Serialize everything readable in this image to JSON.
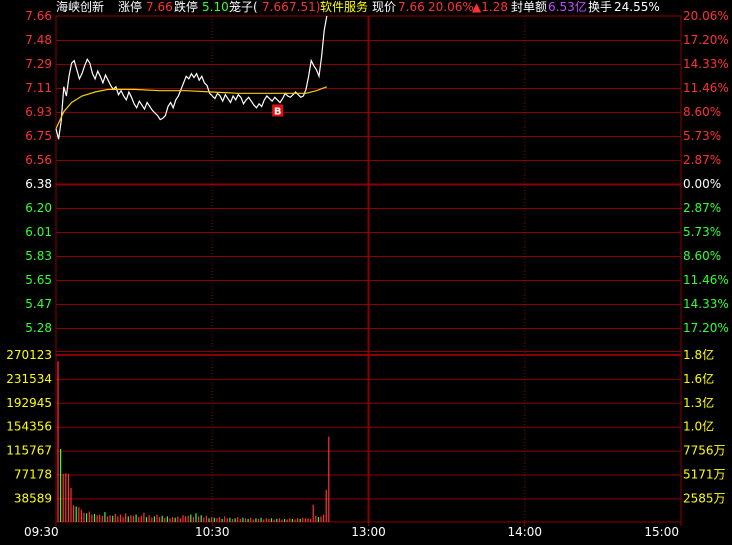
{
  "header": {
    "name": "海峡创新",
    "limit_up_label": "涨停",
    "limit_up": "7.66",
    "limit_down_label": "跌停",
    "limit_down": "5.10",
    "cage_label": "笼子(",
    "cage_value_1": "7.66",
    "cage_value_2": "7.51)",
    "sector": "软件服务",
    "price_label": "现价",
    "price": "7.66",
    "pct": "20.06%",
    "change": "▲1.28",
    "seal_label": "封单额",
    "seal_value": "6.53亿",
    "turnover_label": "换手",
    "turnover": "24.55%"
  },
  "colors": {
    "grid": "#8a0000",
    "up": "#ff3232",
    "down": "#33ff33",
    "neutral": "#ffffff",
    "price_line": "#ffffff",
    "avg_line": "#f0d000",
    "yellow_label": "#ffff00",
    "purple": "#c050ff"
  },
  "trade_marker": "B",
  "chart_data": {
    "type": "line",
    "price_axis_left": [
      "7.66",
      "7.48",
      "7.29",
      "7.11",
      "6.93",
      "6.75",
      "6.56",
      "6.38",
      "6.20",
      "6.01",
      "5.83",
      "5.65",
      "5.47",
      "5.28"
    ],
    "price_axis_right": [
      "20.06%",
      "17.20%",
      "14.33%",
      "11.46%",
      "8.60%",
      "5.73%",
      "2.87%",
      "0.00%",
      "2.87%",
      "5.73%",
      "8.60%",
      "11.46%",
      "14.33%",
      "17.20%"
    ],
    "volume_axis_left": [
      "270123",
      "231534",
      "192945",
      "154356",
      "115767",
      "77178",
      "38589"
    ],
    "volume_axis_right": [
      "1.8亿",
      "1.6亿",
      "1.3亿",
      "1.0亿",
      "7756万",
      "5171万",
      "2585万"
    ],
    "x_ticks": [
      "09:30",
      "10:30",
      "13:00",
      "14:00",
      "15:00"
    ],
    "ylim": [
      5.1,
      7.66
    ],
    "volume_max": 270123,
    "minutes_total": 240,
    "series": [
      {
        "key": "price",
        "points": [
          [
            0,
            6.8
          ],
          [
            1,
            6.72
          ],
          [
            2,
            6.86
          ],
          [
            3,
            7.12
          ],
          [
            4,
            7.05
          ],
          [
            5,
            7.2
          ],
          [
            6,
            7.3
          ],
          [
            7,
            7.32
          ],
          [
            8,
            7.25
          ],
          [
            9,
            7.18
          ],
          [
            10,
            7.22
          ],
          [
            11,
            7.28
          ],
          [
            12,
            7.33
          ],
          [
            13,
            7.3
          ],
          [
            14,
            7.22
          ],
          [
            15,
            7.18
          ],
          [
            16,
            7.24
          ],
          [
            17,
            7.2
          ],
          [
            18,
            7.15
          ],
          [
            19,
            7.21
          ],
          [
            20,
            7.17
          ],
          [
            21,
            7.13
          ],
          [
            22,
            7.1
          ],
          [
            23,
            7.12
          ],
          [
            24,
            7.06
          ],
          [
            25,
            7.09
          ],
          [
            26,
            7.05
          ],
          [
            27,
            7.02
          ],
          [
            28,
            7.08
          ],
          [
            29,
            7.04
          ],
          [
            30,
            6.99
          ],
          [
            31,
            6.96
          ],
          [
            32,
            7.01
          ],
          [
            33,
            6.98
          ],
          [
            34,
            6.95
          ],
          [
            35,
            7.0
          ],
          [
            36,
            6.97
          ],
          [
            37,
            6.94
          ],
          [
            38,
            6.92
          ],
          [
            39,
            6.9
          ],
          [
            40,
            6.87
          ],
          [
            41,
            6.88
          ],
          [
            42,
            6.9
          ],
          [
            43,
            6.97
          ],
          [
            44,
            7.0
          ],
          [
            45,
            6.96
          ],
          [
            46,
            7.02
          ],
          [
            47,
            7.05
          ],
          [
            48,
            7.1
          ],
          [
            49,
            7.15
          ],
          [
            50,
            7.2
          ],
          [
            51,
            7.18
          ],
          [
            52,
            7.22
          ],
          [
            53,
            7.19
          ],
          [
            54,
            7.22
          ],
          [
            55,
            7.17
          ],
          [
            56,
            7.2
          ],
          [
            57,
            7.15
          ],
          [
            58,
            7.13
          ],
          [
            59,
            7.07
          ],
          [
            60,
            7.05
          ],
          [
            61,
            7.03
          ],
          [
            62,
            7.07
          ],
          [
            63,
            7.05
          ],
          [
            64,
            7.01
          ],
          [
            65,
            7.06
          ],
          [
            66,
            7.03
          ],
          [
            67,
            7.0
          ],
          [
            68,
            7.05
          ],
          [
            69,
            7.02
          ],
          [
            70,
            7.06
          ],
          [
            71,
            7.04
          ],
          [
            72,
            6.99
          ],
          [
            73,
            7.02
          ],
          [
            74,
            7.04
          ],
          [
            75,
            7.01
          ],
          [
            76,
            6.98
          ],
          [
            77,
            6.96
          ],
          [
            78,
            6.99
          ],
          [
            79,
            6.97
          ],
          [
            80,
            7.02
          ],
          [
            81,
            7.05
          ],
          [
            82,
            7.03
          ],
          [
            83,
            7.01
          ],
          [
            84,
            7.04
          ],
          [
            85,
            7.02
          ],
          [
            86,
            7.0
          ],
          [
            87,
            7.03
          ],
          [
            88,
            7.07
          ],
          [
            89,
            7.05
          ],
          [
            90,
            7.04
          ],
          [
            91,
            7.06
          ],
          [
            92,
            7.08
          ],
          [
            93,
            7.06
          ],
          [
            94,
            7.04
          ],
          [
            95,
            7.05
          ],
          [
            96,
            7.1
          ],
          [
            97,
            7.2
          ],
          [
            98,
            7.32
          ],
          [
            99,
            7.28
          ],
          [
            100,
            7.25
          ],
          [
            101,
            7.2
          ],
          [
            102,
            7.35
          ],
          [
            103,
            7.55
          ],
          [
            104,
            7.66
          ]
        ]
      },
      {
        "key": "average",
        "points": [
          [
            0,
            6.8
          ],
          [
            3,
            6.93
          ],
          [
            6,
            7.0
          ],
          [
            10,
            7.05
          ],
          [
            15,
            7.08
          ],
          [
            20,
            7.1
          ],
          [
            30,
            7.1
          ],
          [
            40,
            7.09
          ],
          [
            50,
            7.09
          ],
          [
            60,
            7.08
          ],
          [
            70,
            7.07
          ],
          [
            80,
            7.07
          ],
          [
            90,
            7.07
          ],
          [
            96,
            7.07
          ],
          [
            100,
            7.09
          ],
          [
            104,
            7.12
          ]
        ]
      }
    ],
    "volume": [
      260000,
      118000,
      78000,
      79000,
      78000,
      55000,
      27000,
      25000,
      24000,
      20000,
      15000,
      14000,
      17000,
      12000,
      13000,
      11000,
      12000,
      10000,
      16000,
      9000,
      11000,
      10000,
      13000,
      9000,
      12000,
      8000,
      14000,
      9000,
      11000,
      10000,
      12000,
      8000,
      10000,
      15000,
      8000,
      11000,
      7000,
      9000,
      12000,
      8000,
      10000,
      7000,
      9000,
      6000,
      8000,
      7000,
      9000,
      6000,
      11000,
      9000,
      10000,
      12000,
      8000,
      14000,
      9000,
      11000,
      7000,
      10000,
      6000,
      8000,
      7000,
      6000,
      8000,
      5000,
      9000,
      6000,
      7000,
      5000,
      6000,
      8000,
      5000,
      7000,
      6000,
      5000,
      7000,
      4000,
      6000,
      5000,
      7000,
      4000,
      6000,
      5000,
      6000,
      4000,
      5000,
      6000,
      4000,
      5000,
      4000,
      6000,
      5000,
      4000,
      6000,
      5000,
      7000,
      6000,
      6000,
      5000,
      28000,
      10000,
      8000,
      9000,
      12000,
      52000,
      138000
    ],
    "volume_colors": [
      1,
      0,
      1,
      1,
      1,
      1,
      1,
      0,
      1,
      1,
      1,
      0,
      1,
      1,
      0,
      1,
      1,
      1,
      0,
      1,
      1,
      0,
      1,
      1,
      1,
      1,
      1,
      0,
      1,
      1,
      0,
      1,
      1,
      1,
      0,
      1,
      1,
      0,
      1,
      1,
      0,
      1,
      0,
      1,
      1,
      0,
      1,
      1,
      1,
      1,
      1,
      0,
      1,
      0,
      1,
      0,
      1,
      1,
      0,
      1,
      0,
      1,
      1,
      0,
      1,
      1,
      0,
      1,
      0,
      1,
      1,
      0,
      1,
      0,
      1,
      1,
      0,
      1,
      0,
      1,
      1,
      1,
      0,
      1,
      0,
      1,
      1,
      0,
      1,
      1,
      0,
      1,
      1,
      0,
      1,
      1,
      1,
      1,
      1,
      1,
      0,
      1,
      1,
      1,
      1
    ]
  }
}
